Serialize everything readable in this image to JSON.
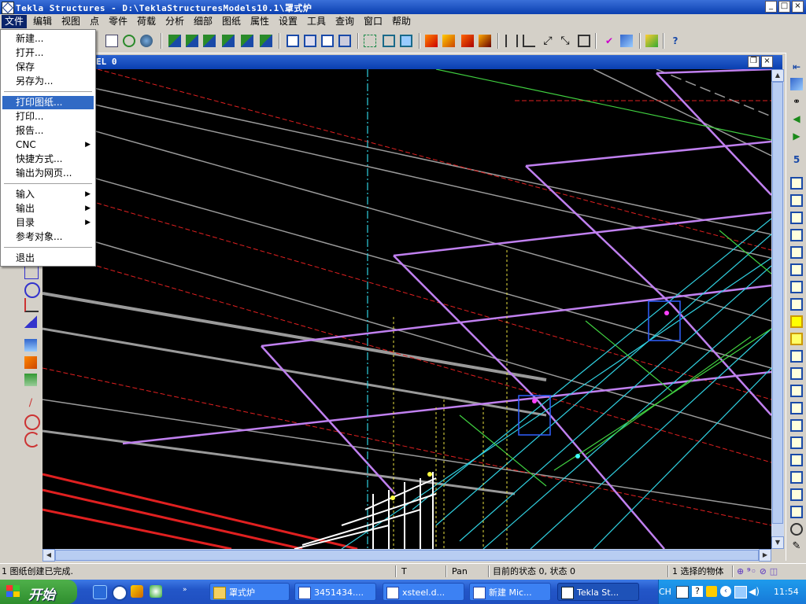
{
  "window": {
    "title": "Tekla Structures - D:\\TeklaStructuresModels10.1\\罩式炉",
    "controls": {
      "minimize": "_",
      "maximize": "□",
      "close": "×"
    }
  },
  "menubar": {
    "items": [
      "文件",
      "编辑",
      "视图",
      "点",
      "零件",
      "荷载",
      "分析",
      "细部",
      "图纸",
      "属性",
      "设置",
      "工具",
      "查询",
      "窗口",
      "帮助"
    ]
  },
  "file_menu": {
    "groups": [
      [
        {
          "label": "新建...",
          "submenu": false
        },
        {
          "label": "打开...",
          "submenu": false
        },
        {
          "label": "保存",
          "submenu": false
        },
        {
          "label": "另存为...",
          "submenu": false
        }
      ],
      [
        {
          "label": "打印图纸...",
          "submenu": false,
          "highlighted": true
        },
        {
          "label": "打印...",
          "submenu": false
        },
        {
          "label": "报告...",
          "submenu": false
        },
        {
          "label": "CNC",
          "submenu": true
        },
        {
          "label": "快捷方式...",
          "submenu": false
        },
        {
          "label": "输出为网页...",
          "submenu": false
        }
      ],
      [
        {
          "label": "输入",
          "submenu": true
        },
        {
          "label": "输出",
          "submenu": true
        },
        {
          "label": "目录",
          "submenu": true
        },
        {
          "label": "参考对象...",
          "submenu": false
        }
      ],
      [
        {
          "label": "退出",
          "submenu": false
        }
      ]
    ]
  },
  "view": {
    "title": "EL 0",
    "controls": {
      "restore": "❐",
      "close": "×"
    }
  },
  "statusbar": {
    "message": "1 图纸创建已完成.",
    "field1": "T",
    "field2": "Pan",
    "state": "目前的状态 0, 状态 0",
    "selection": "1 选择的物体"
  },
  "taskbar": {
    "start_label": "开始",
    "tasks": [
      {
        "label": "罩式炉",
        "icon": "folder-icon",
        "active": false
      },
      {
        "label": "3451434....",
        "icon": "word-icon",
        "active": false
      },
      {
        "label": "xsteel.d...",
        "icon": "word-icon",
        "active": false
      },
      {
        "label": "新建 Mic...",
        "icon": "word-icon",
        "active": false
      },
      {
        "label": "Tekla St...",
        "icon": "tekla-icon",
        "active": true
      }
    ],
    "ime": "CH",
    "clock": "11:54"
  },
  "colors": {
    "canvas_bg": "#000000",
    "beam_purple": "#c080f0",
    "grid_cyan": "#30d0e0",
    "line_red": "#e02020",
    "line_gray": "#9a9a9a",
    "line_yellow": "#e8e040",
    "line_green": "#40d040",
    "menu_highlight": "#316ac5"
  }
}
